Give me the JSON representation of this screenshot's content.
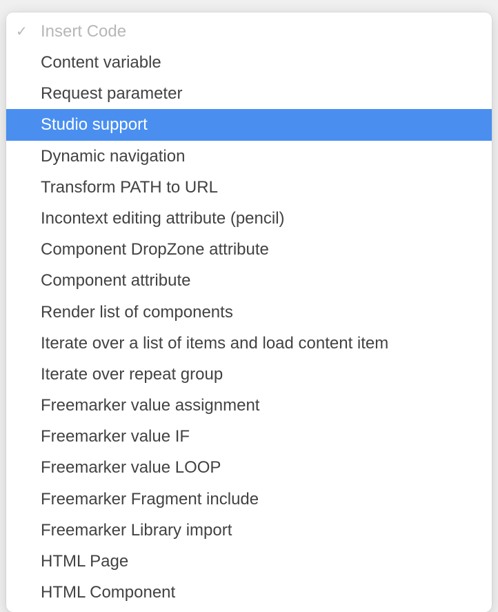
{
  "menu": {
    "header": "Insert Code",
    "items": [
      {
        "label": "Content variable",
        "selected": false
      },
      {
        "label": "Request parameter",
        "selected": false
      },
      {
        "label": "Studio support",
        "selected": true
      },
      {
        "label": "Dynamic navigation",
        "selected": false
      },
      {
        "label": "Transform PATH to URL",
        "selected": false
      },
      {
        "label": "Incontext editing attribute (pencil)",
        "selected": false
      },
      {
        "label": "Component DropZone attribute",
        "selected": false
      },
      {
        "label": "Component attribute",
        "selected": false
      },
      {
        "label": "Render list of components",
        "selected": false
      },
      {
        "label": "Iterate over a list of items and load content item",
        "selected": false
      },
      {
        "label": "Iterate over repeat group",
        "selected": false
      },
      {
        "label": "Freemarker value assignment",
        "selected": false
      },
      {
        "label": "Freemarker value IF",
        "selected": false
      },
      {
        "label": "Freemarker value LOOP",
        "selected": false
      },
      {
        "label": "Freemarker Fragment include",
        "selected": false
      },
      {
        "label": "Freemarker Library import",
        "selected": false
      },
      {
        "label": "HTML Page",
        "selected": false
      },
      {
        "label": "HTML Component",
        "selected": false
      }
    ]
  }
}
